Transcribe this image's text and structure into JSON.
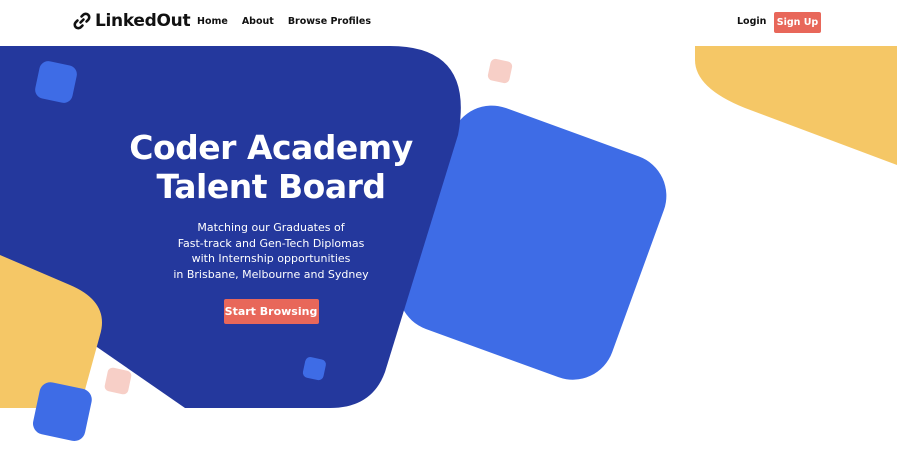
{
  "navbar": {
    "brand": "LinkedOut",
    "brand_icon": "link-icon",
    "links": [
      {
        "label": "Home"
      },
      {
        "label": "About"
      },
      {
        "label": "Browse Profiles"
      }
    ],
    "login_label": "Login",
    "signup_label": "Sign Up"
  },
  "hero": {
    "title_lines": [
      "Coder Academy",
      "Talent Board"
    ],
    "description_lines": [
      "Matching our Graduates of",
      "Fast-track and Gen-Tech Diplomas",
      "with Internship opportunities",
      "in Brisbane, Melbourne and Sydney"
    ],
    "cta_label": "Start Browsing"
  },
  "colors": {
    "dark_blue": "#24389d",
    "bright_blue": "#3e6ce6",
    "yellow": "#f5c766",
    "salmon": "#e8675a",
    "pale_pink": "#f7cfc7"
  }
}
